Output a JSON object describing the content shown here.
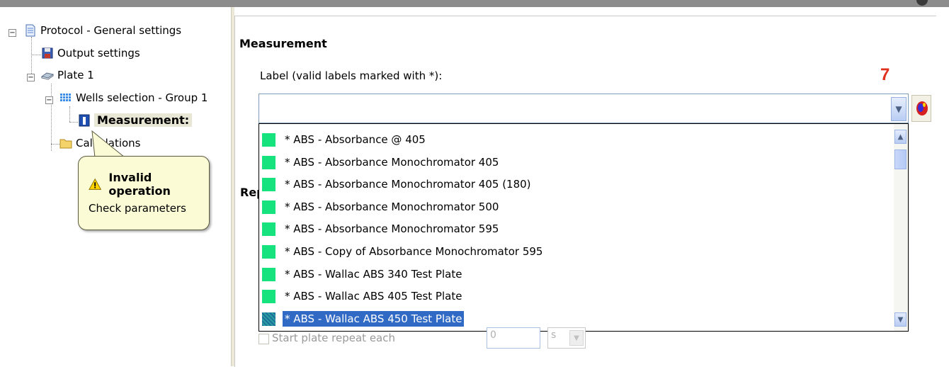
{
  "tree": {
    "nodes": [
      {
        "label": "Protocol - General settings",
        "icon": "document-icon",
        "expander": "−"
      },
      {
        "label": "Output settings",
        "icon": "save-icon"
      },
      {
        "label": "Plate 1",
        "icon": "plate-icon",
        "expander": "−"
      },
      {
        "label": "Wells selection - Group 1",
        "icon": "grid-icon",
        "expander": "−"
      },
      {
        "label": "Measurement:",
        "icon": "measurement-icon",
        "selected": true
      },
      {
        "label": "Calculations",
        "icon": "folder-icon"
      }
    ]
  },
  "tooltip": {
    "title": "Invalid operation",
    "message": "Check parameters",
    "icon": "warning-icon"
  },
  "measurement": {
    "section_title": "Measurement",
    "label_text": "Label (valid labels marked with *):",
    "combo_value": "",
    "annotation": "7",
    "repeat_partial": "Rep"
  },
  "dropdown": {
    "items": [
      "* ABS - Absorbance @ 405",
      "* ABS - Absorbance Monochromator 405",
      "* ABS - Absorbance Monochromator 405 (180)",
      "* ABS - Absorbance Monochromator 500",
      "* ABS - Absorbance Monochromator 595",
      "* ABS - Copy of Absorbance Monochromator 595",
      "* ABS - Wallac ABS 340 Test Plate",
      "* ABS - Wallac ABS 405 Test Plate",
      "* ABS - Wallac ABS 450 Test Plate"
    ],
    "selected_index": 8,
    "swatch_color": "#16e27e"
  },
  "plate_repeat": {
    "checkbox_label": "Start plate repeat each",
    "value": "0",
    "unit": "s"
  }
}
